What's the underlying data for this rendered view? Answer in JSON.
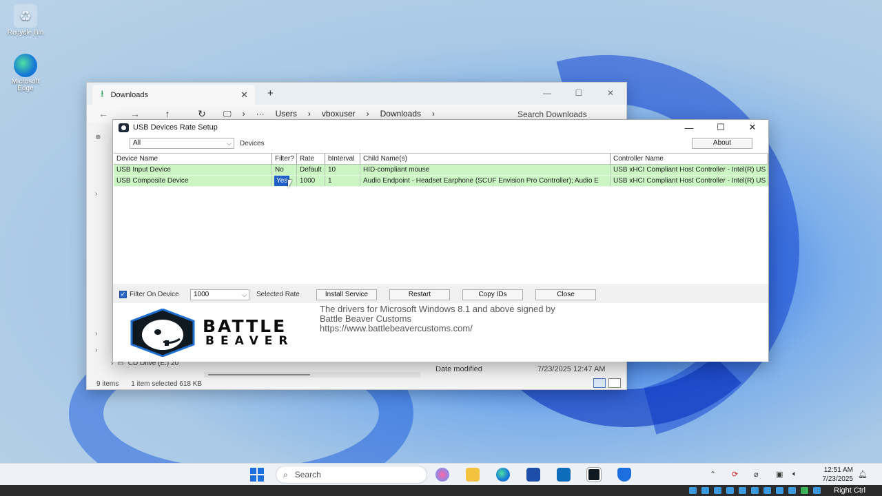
{
  "desktop": {
    "icons": [
      {
        "label": "Recycle Bin"
      },
      {
        "label": "Microsoft Edge"
      }
    ]
  },
  "explorer": {
    "tab_title": "Downloads",
    "new_tab": "+",
    "breadcrumbs": [
      "Users",
      "vboxuser",
      "Downloads"
    ],
    "search_placeholder": "Search Downloads",
    "cd_drive": "CD Drive (E:) 20",
    "date_modified_header": "Date modified",
    "date_modified_value": "7/23/2025 12:47 AM",
    "status_items": "9 items",
    "status_selected": "1 item selected",
    "status_size": "618 KB"
  },
  "usb_dialog": {
    "title": "USB Devices Rate Setup",
    "filter_select": "All",
    "devices_label": "Devices",
    "about_button": "About",
    "columns": [
      "Device Name",
      "Filter?",
      "Rate",
      "bInterval",
      "Child Name(s)",
      "Controller Name"
    ],
    "rows": [
      {
        "device": "USB Input Device",
        "filter": "No",
        "rate": "Default",
        "binterval": "10",
        "child": "HID-compliant mouse",
        "controller": "USB xHCI Compliant Host Controller - Intel(R) US"
      },
      {
        "device": "USB Composite Device",
        "filter": "Yes",
        "rate": "1000",
        "binterval": "1",
        "child": "Audio Endpoint - Headset Earphone (SCUF Envision Pro Controller); Audio E",
        "controller": "USB xHCI Compliant Host Controller - Intel(R) US"
      }
    ],
    "filter_on_device_label": "Filter On Device",
    "filter_on_device_checked": true,
    "rate_select": "1000",
    "selected_rate_label": "Selected Rate",
    "install_service_button": "Install Service",
    "restart_button": "Restart",
    "copy_ids_button": "Copy IDs",
    "close_button": "Close",
    "logo_line1": "BATTLE",
    "logo_line2": "BEAVER",
    "info_line1": "The drivers for Microsoft Windows 8.1 and above signed by",
    "info_line2": "Battle Beaver Customs",
    "info_line3": "https://www.battlebeavercustoms.com/"
  },
  "taskbar": {
    "search_label": "Search",
    "time": "12:51 AM",
    "date": "7/23/2025"
  },
  "vm_bar": {
    "host_key": "Right Ctrl"
  },
  "colors": {
    "row_green": "#ccf5c4",
    "selection_blue": "#1f5fc7",
    "accent": "#2a66c7"
  }
}
